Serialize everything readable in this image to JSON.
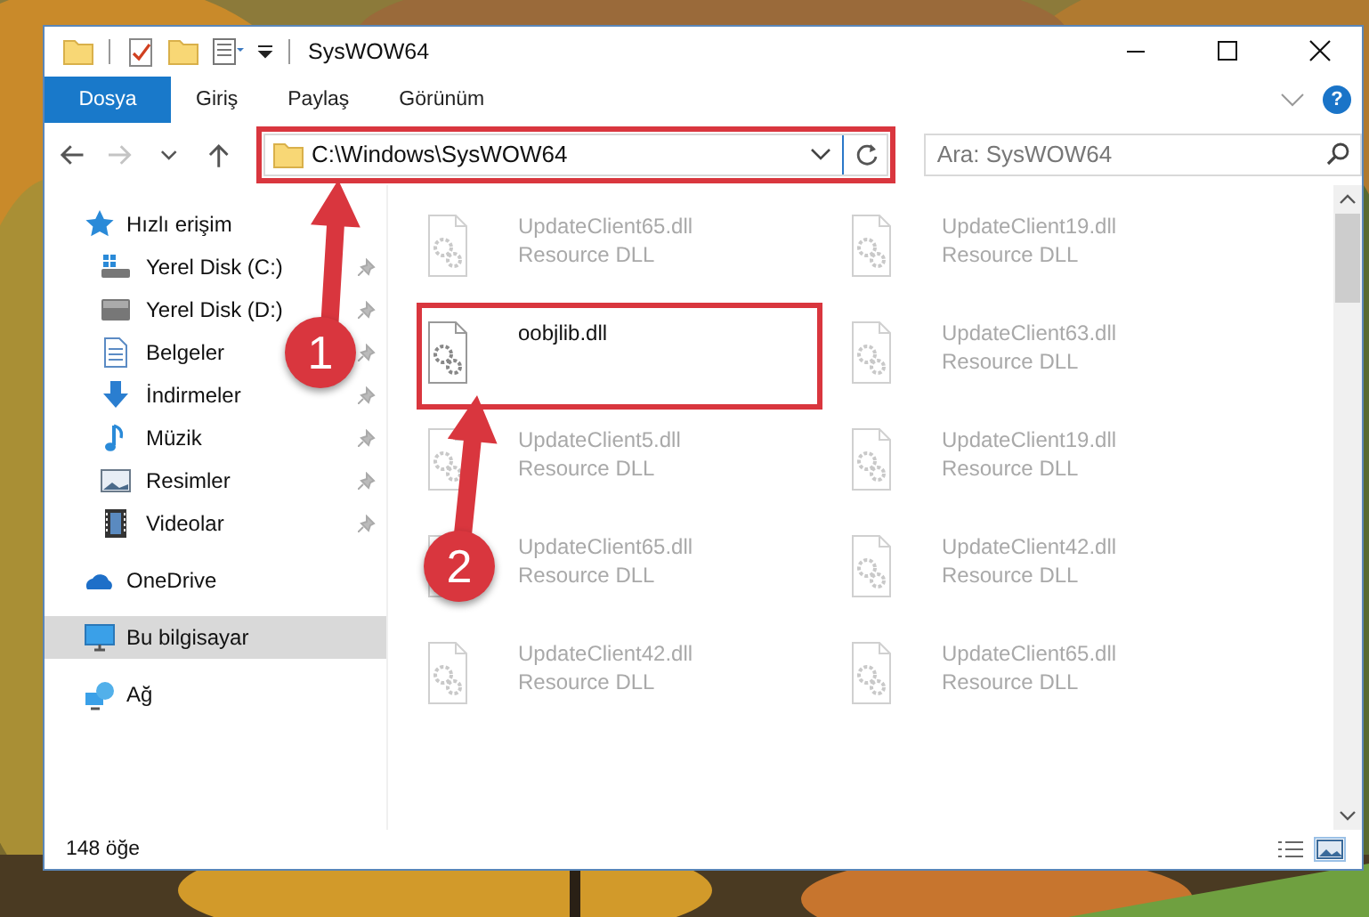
{
  "window": {
    "title": "SysWOW64"
  },
  "ribbon_tabs": [
    {
      "label": "Dosya",
      "kind": "file"
    },
    {
      "label": "Giriş",
      "kind": "tab"
    },
    {
      "label": "Paylaş",
      "kind": "tab"
    },
    {
      "label": "Görünüm",
      "kind": "tab"
    }
  ],
  "help": "?",
  "nav_buttons": [
    {
      "kind": "back",
      "disabled": false
    },
    {
      "kind": "forward",
      "disabled": true
    },
    {
      "kind": "recent",
      "disabled": false
    },
    {
      "kind": "up",
      "disabled": false
    }
  ],
  "address_bar": {
    "value": "C:\\Windows\\SysWOW64",
    "highlighted": true
  },
  "search": {
    "placeholder": "Ara: SysWOW64"
  },
  "sidebar": {
    "items": [
      {
        "label": "Hızlı erişim",
        "kind": "quick",
        "selected": false,
        "children": [
          {
            "label": "Yerel Disk (C:)",
            "kind": "drive-c",
            "pinned": true,
            "selected": false
          },
          {
            "label": "Yerel Disk (D:)",
            "kind": "drive",
            "pinned": true,
            "selected": false
          },
          {
            "label": "Belgeler",
            "kind": "documents",
            "pinned": true,
            "selected": false
          },
          {
            "label": "İndirmeler",
            "kind": "downloads",
            "pinned": true,
            "selected": false
          },
          {
            "label": "Müzik",
            "kind": "music",
            "pinned": true,
            "selected": false
          },
          {
            "label": "Resimler",
            "kind": "pictures",
            "pinned": true,
            "selected": false
          },
          {
            "label": "Videolar",
            "kind": "videos",
            "pinned": true,
            "selected": false
          }
        ]
      },
      {
        "label": "OneDrive",
        "kind": "cloud",
        "selected": false
      },
      {
        "label": "Bu bilgisayar",
        "kind": "computer",
        "selected": true
      },
      {
        "label": "Ağ",
        "kind": "network",
        "selected": false
      }
    ]
  },
  "files": [
    {
      "name": "UpdateClient65.dll",
      "type": "Resource DLL",
      "dimmed": true,
      "highlighted": false
    },
    {
      "name": "UpdateClient19.dll",
      "type": "Resource DLL",
      "dimmed": true,
      "highlighted": false
    },
    {
      "name": "oobjlib.dll",
      "dimmed": false,
      "highlighted": true
    },
    {
      "name": "UpdateClient63.dll",
      "type": "Resource DLL",
      "dimmed": true,
      "highlighted": false
    },
    {
      "name": "UpdateClient5.dll",
      "type": "Resource DLL",
      "dimmed": true,
      "highlighted": false
    },
    {
      "name": "UpdateClient19.dll",
      "type": "Resource DLL",
      "dimmed": true,
      "highlighted": false
    },
    {
      "name": "UpdateClient65.dll",
      "type": "Resource DLL",
      "dimmed": true,
      "highlighted": false
    },
    {
      "name": "UpdateClient42.dll",
      "type": "Resource DLL",
      "dimmed": true,
      "highlighted": false
    },
    {
      "name": "UpdateClient42.dll",
      "type": "Resource DLL",
      "dimmed": true,
      "highlighted": false
    },
    {
      "name": "UpdateClient65.dll",
      "type": "Resource DLL",
      "dimmed": true,
      "highlighted": false
    }
  ],
  "status_bar": {
    "count": "148 öğe"
  },
  "annotations": [
    {
      "label": "1"
    },
    {
      "label": "2"
    }
  ]
}
